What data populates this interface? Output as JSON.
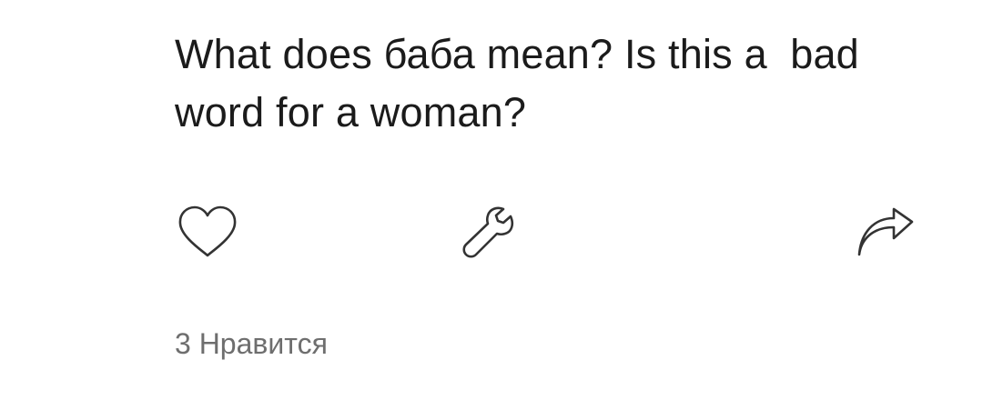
{
  "post": {
    "text": "What does баба mean? Is this a  bad\nword for a woman?"
  },
  "actions": {
    "like_icon": "heart-outline-icon",
    "tools_icon": "wrench-icon",
    "share_icon": "share-arrow-icon"
  },
  "likes": {
    "label": "3 Нравится"
  },
  "colors": {
    "text": "#1b1b1b",
    "secondary_text": "#6e6e6e",
    "icon_stroke": "#333333",
    "background": "#ffffff"
  }
}
